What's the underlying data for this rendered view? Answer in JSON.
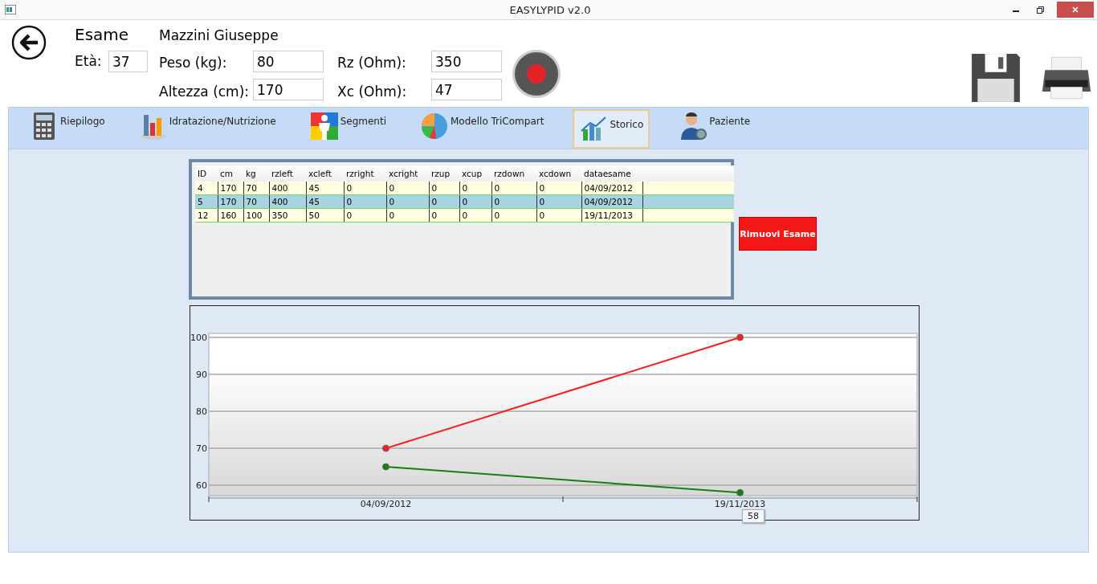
{
  "window": {
    "title": "EASYLYPID v2.0"
  },
  "header": {
    "title": "Esame",
    "patient": "Mazzini Giuseppe",
    "fields": [
      {
        "label": "Età:",
        "value": "37"
      },
      {
        "label": "Peso (kg):",
        "value": "80"
      },
      {
        "label": "Rz (Ohm):",
        "value": "350"
      },
      {
        "label": "Altezza (cm):",
        "value": "170"
      },
      {
        "label": "Xc (Ohm):",
        "value": "47"
      }
    ]
  },
  "tabs": [
    {
      "label": "Riepilogo",
      "selected": false
    },
    {
      "label": "Idratazione/Nutrizione",
      "selected": false
    },
    {
      "label": "Segmenti",
      "selected": false
    },
    {
      "label": "Modello TriCompart",
      "selected": false
    },
    {
      "label": "Storico",
      "selected": true
    },
    {
      "label": "Paziente",
      "selected": false
    }
  ],
  "table": {
    "columns": [
      "ID",
      "cm",
      "kg",
      "rzleft",
      "xcleft",
      "rzright",
      "xcright",
      "rzup",
      "xcup",
      "rzdown",
      "xcdown",
      "dataesame"
    ],
    "rows": [
      {
        "cells": [
          "4",
          "170",
          "70",
          "400",
          "45",
          "0",
          "0",
          "0",
          "0",
          "0",
          "0",
          "04/09/2012"
        ],
        "selected": false
      },
      {
        "cells": [
          "5",
          "170",
          "70",
          "400",
          "45",
          "0",
          "0",
          "0",
          "0",
          "0",
          "0",
          "04/09/2012"
        ],
        "selected": true
      },
      {
        "cells": [
          "12",
          "160",
          "100",
          "350",
          "50",
          "0",
          "0",
          "0",
          "0",
          "0",
          "0",
          "19/11/2013"
        ],
        "selected": false
      }
    ]
  },
  "remove_button": "Rimuovi Esame",
  "chart": {
    "tooltip": "58",
    "chart_data": {
      "type": "line",
      "categories": [
        "04/09/2012",
        "19/11/2013"
      ],
      "grid": true,
      "series": [
        {
          "color": "#ff1a1a",
          "marker": true,
          "values": [
            70,
            100
          ]
        },
        {
          "color": "#128012",
          "marker": true,
          "values": [
            65,
            58
          ]
        }
      ],
      "ylim": [
        57.2,
        101.1
      ],
      "yticks": [
        60,
        70,
        80,
        90,
        100
      ]
    }
  }
}
